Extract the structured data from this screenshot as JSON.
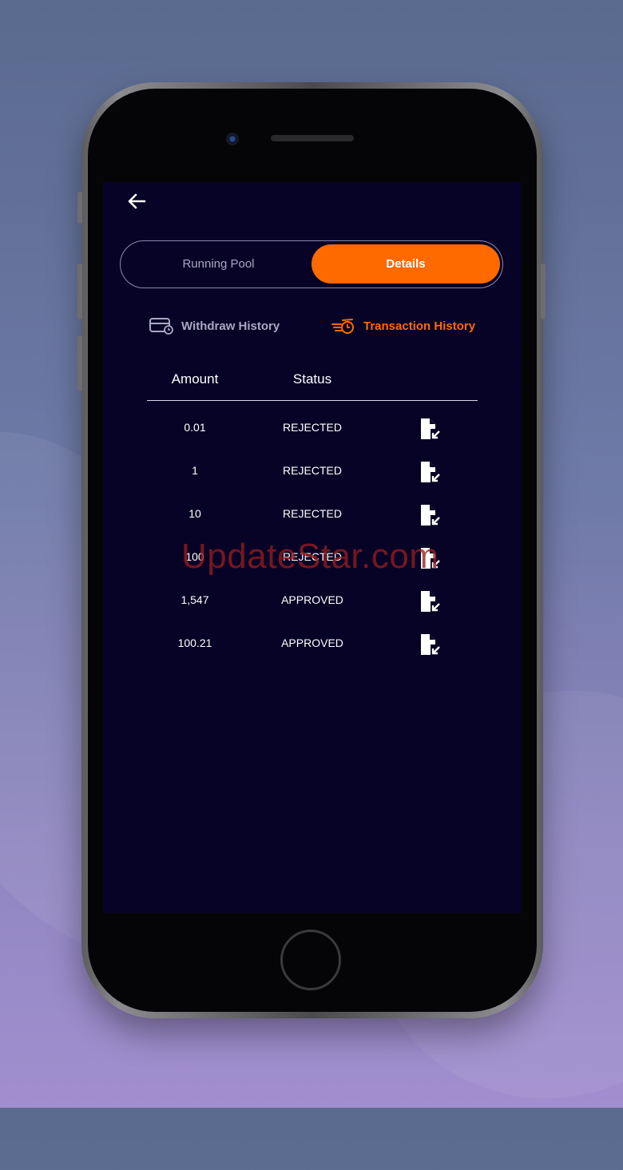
{
  "screen": {
    "segment": {
      "left_label": "Running Pool",
      "right_label": "Details",
      "active": "Details"
    },
    "tabs": [
      {
        "label": "Withdraw History",
        "icon": "card-clock-icon",
        "active": false
      },
      {
        "label": "Transaction History",
        "icon": "fast-clock-icon",
        "active": true
      }
    ],
    "table": {
      "headers": [
        "Amount",
        "Status"
      ],
      "rows": [
        {
          "amount": "0.01",
          "status": "REJECTED",
          "icon": "document-export-icon"
        },
        {
          "amount": "1",
          "status": "REJECTED",
          "icon": "document-export-icon"
        },
        {
          "amount": "10",
          "status": "REJECTED",
          "icon": "document-export-icon"
        },
        {
          "amount": "100",
          "status": "REJECTED",
          "icon": "document-export-icon"
        },
        {
          "amount": "1,547",
          "status": "APPROVED",
          "icon": "document-export-icon"
        },
        {
          "amount": "100.21",
          "status": "APPROVED",
          "icon": "document-export-icon"
        }
      ]
    },
    "colors": {
      "accent": "#ff6a00",
      "background": "#070326",
      "muted": "#a9a7c3"
    }
  },
  "watermark": "UpdateStar.com"
}
